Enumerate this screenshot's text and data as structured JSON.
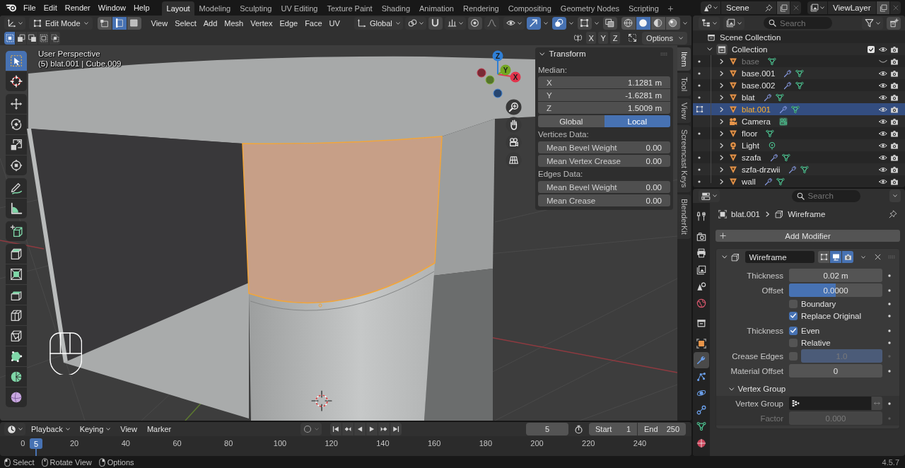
{
  "top_bar": {
    "menus": [
      "File",
      "Edit",
      "Render",
      "Window",
      "Help"
    ],
    "workspaces": [
      {
        "label": "Layout",
        "selected": true
      },
      {
        "label": "Modeling",
        "selected": false
      },
      {
        "label": "Sculpting",
        "selected": false
      },
      {
        "label": "UV Editing",
        "selected": false
      },
      {
        "label": "Texture Paint",
        "selected": false
      },
      {
        "label": "Shading",
        "selected": false
      },
      {
        "label": "Animation",
        "selected": false
      },
      {
        "label": "Rendering",
        "selected": false
      },
      {
        "label": "Compositing",
        "selected": false
      },
      {
        "label": "Geometry Nodes",
        "selected": false
      },
      {
        "label": "Scripting",
        "selected": false
      }
    ],
    "add_workspace": "+",
    "scene": "Scene",
    "view_layer": "ViewLayer"
  },
  "viewport": {
    "header": {
      "mode": "Edit Mode",
      "select_modes": [
        {
          "kind": "vertex",
          "selected": false
        },
        {
          "kind": "edge",
          "selected": true
        },
        {
          "kind": "face",
          "selected": false
        }
      ],
      "menus": [
        "View",
        "Select",
        "Add",
        "Mesh",
        "Vertex",
        "Edge",
        "Face",
        "UV"
      ],
      "orientation": "Global",
      "view_toggles": [
        {
          "kind": "gizmos",
          "on": true
        },
        {
          "kind": "overlays",
          "on": true
        },
        {
          "kind": "mesh_overlays",
          "on": false
        },
        {
          "kind": "xray",
          "on": false
        }
      ],
      "shading": [
        {
          "kind": "wireframe",
          "selected": false
        },
        {
          "kind": "solid",
          "selected": true
        },
        {
          "kind": "material",
          "selected": false
        },
        {
          "kind": "rendered",
          "selected": false
        }
      ],
      "select_ops": [
        {
          "kind": "set",
          "selected": true
        },
        {
          "kind": "extend",
          "selected": false
        },
        {
          "kind": "subtract",
          "selected": false
        },
        {
          "kind": "invert",
          "selected": false
        },
        {
          "kind": "intersect",
          "selected": false
        }
      ],
      "mirror_axes": [
        "X",
        "Y",
        "Z"
      ],
      "options": "Options"
    },
    "tool_groups": [
      {
        "tools": [
          {
            "kind": "select_box",
            "selected": true
          },
          {
            "kind": "cursor",
            "selected": false
          }
        ]
      },
      {
        "tools": [
          {
            "kind": "move",
            "selected": false
          },
          {
            "kind": "rotate",
            "selected": false
          },
          {
            "kind": "scale",
            "selected": false
          },
          {
            "kind": "transform",
            "selected": false
          }
        ]
      },
      {
        "tools": [
          {
            "kind": "annotate",
            "selected": false
          },
          {
            "kind": "measure",
            "selected": false
          }
        ]
      },
      {
        "tools": [
          {
            "kind": "add_cube",
            "selected": false
          }
        ]
      },
      {
        "tools": [
          {
            "kind": "extrude",
            "selected": false
          },
          {
            "kind": "inset",
            "selected": false
          },
          {
            "kind": "bevel",
            "selected": false
          },
          {
            "kind": "loop_cut",
            "selected": false
          },
          {
            "kind": "knife",
            "selected": false
          },
          {
            "kind": "poly_build",
            "selected": false
          },
          {
            "kind": "spin",
            "selected": false
          },
          {
            "kind": "smooth",
            "selected": false
          }
        ]
      }
    ],
    "view_name": "User Perspective",
    "object_info": "(5) blat.001 | Cube.009",
    "axes": [
      {
        "label": "X",
        "color": "#e2344c"
      },
      {
        "label": "Y",
        "color": "#74a722"
      },
      {
        "label": "Z",
        "color": "#2f7fd6"
      }
    ],
    "sidebar": {
      "tabs": [
        {
          "label": "Item",
          "selected": true
        },
        {
          "label": "Tool",
          "selected": false
        },
        {
          "label": "View",
          "selected": false
        },
        {
          "label": "Screencast Keys",
          "selected": false
        },
        {
          "label": "BlenderKit",
          "selected": false
        }
      ],
      "panel": {
        "title": "Transform",
        "expanded": true,
        "median_label": "Median:",
        "median": [
          {
            "axis": "X",
            "value": "1.1281 m"
          },
          {
            "axis": "Y",
            "value": "-1.6281 m"
          },
          {
            "axis": "Z",
            "value": "1.5009 m"
          }
        ],
        "space": [
          {
            "label": "Global",
            "selected": false
          },
          {
            "label": "Local",
            "selected": true
          }
        ],
        "groups": [
          {
            "title": "Vertices Data:",
            "fields": [
              {
                "label": "Mean Bevel Weight",
                "value": "0.00"
              },
              {
                "label": "Mean Vertex Crease",
                "value": "0.00"
              }
            ]
          },
          {
            "title": "Edges Data:",
            "fields": [
              {
                "label": "Mean Bevel Weight",
                "value": "0.00"
              },
              {
                "label": "Mean Crease",
                "value": "0.00"
              }
            ]
          }
        ]
      }
    }
  },
  "timeline": {
    "menus": [
      {
        "label": "Playback",
        "dropdown": true
      },
      {
        "label": "Keying",
        "dropdown": true
      },
      {
        "label": "View",
        "dropdown": false
      },
      {
        "label": "Marker",
        "dropdown": false
      }
    ],
    "current_frame": "5",
    "start": {
      "label": "Start",
      "value": "1"
    },
    "end": {
      "label": "End",
      "value": "250"
    },
    "ruler": [
      "0",
      "20",
      "40",
      "60",
      "80",
      "100",
      "120",
      "140",
      "160",
      "180",
      "200",
      "220",
      "240"
    ],
    "playhead": "5"
  },
  "outliner": {
    "search": {
      "placeholder": "Search"
    },
    "tree": {
      "label": "Scene Collection",
      "children": [
        {
          "label": "Collection",
          "expanded": true,
          "checked": true,
          "children": [
            {
              "name": "base",
              "kind": "mesh",
              "expanded": false,
              "modifiers": false,
              "visible": false,
              "selected": false,
              "edit_mode": false
            },
            {
              "name": "base.001",
              "kind": "mesh",
              "expanded": false,
              "modifiers": true,
              "visible": true,
              "selected": false,
              "edit_mode": false
            },
            {
              "name": "base.002",
              "kind": "mesh",
              "expanded": false,
              "modifiers": true,
              "visible": true,
              "selected": false,
              "edit_mode": false
            },
            {
              "name": "blat",
              "kind": "mesh",
              "expanded": false,
              "modifiers": true,
              "visible": true,
              "selected": false,
              "edit_mode": false
            },
            {
              "name": "blat.001",
              "kind": "mesh",
              "expanded": false,
              "modifiers": true,
              "visible": true,
              "selected": true,
              "edit_mode": true
            },
            {
              "name": "Camera",
              "kind": "camera",
              "expanded": false,
              "modifiers": false,
              "visible": true,
              "selected": false,
              "edit_mode": false
            },
            {
              "name": "floor",
              "kind": "mesh",
              "expanded": false,
              "modifiers": false,
              "visible": true,
              "selected": false,
              "edit_mode": false
            },
            {
              "name": "Light",
              "kind": "light",
              "expanded": false,
              "modifiers": false,
              "visible": true,
              "selected": false,
              "edit_mode": false
            },
            {
              "name": "szafa",
              "kind": "mesh",
              "expanded": false,
              "modifiers": true,
              "visible": true,
              "selected": false,
              "edit_mode": false
            },
            {
              "name": "szfa-drzwii",
              "kind": "mesh",
              "expanded": false,
              "modifiers": true,
              "visible": true,
              "selected": false,
              "edit_mode": false
            },
            {
              "name": "wall",
              "kind": "mesh",
              "expanded": false,
              "modifiers": true,
              "visible": true,
              "selected": false,
              "edit_mode": false
            }
          ]
        }
      ]
    }
  },
  "properties": {
    "search": {
      "placeholder": "Search"
    },
    "tab_groups": [
      {
        "tabs": [
          {
            "kind": "tool",
            "selected": false
          }
        ]
      },
      {
        "tabs": [
          {
            "kind": "render",
            "selected": false
          },
          {
            "kind": "output",
            "selected": false
          },
          {
            "kind": "view_layer",
            "selected": false
          },
          {
            "kind": "scene",
            "selected": false
          },
          {
            "kind": "world",
            "selected": false
          }
        ]
      },
      {
        "tabs": [
          {
            "kind": "collection",
            "selected": false
          }
        ]
      },
      {
        "tabs": [
          {
            "kind": "object",
            "selected": false
          },
          {
            "kind": "modifiers",
            "selected": true
          },
          {
            "kind": "particles",
            "selected": false
          },
          {
            "kind": "physics",
            "selected": false
          },
          {
            "kind": "constraints",
            "selected": false
          },
          {
            "kind": "data",
            "selected": false
          },
          {
            "kind": "material",
            "selected": false
          }
        ]
      }
    ],
    "breadcrumb": [
      {
        "kind": "object",
        "label": "blat.001"
      },
      {
        "kind": "modifier",
        "label": "Wireframe"
      }
    ],
    "add_modifier": "Add Modifier",
    "modifier": {
      "name": "Wireframe",
      "expanded": true,
      "toggles": [
        {
          "kind": "edit_mode",
          "on": false
        },
        {
          "kind": "viewport",
          "on": true
        },
        {
          "kind": "render",
          "on": true
        }
      ],
      "rows": [
        {
          "kind": "number",
          "label": "Thickness",
          "value": "0.02 m",
          "disabled": false
        },
        {
          "kind": "slider",
          "label": "Offset",
          "value": "0.0000",
          "level": 0.5,
          "disabled": false
        },
        {
          "kind": "checkbox",
          "text": "Boundary",
          "checked": false,
          "disabled": false
        },
        {
          "kind": "checkbox",
          "text": "Replace Original",
          "checked": true,
          "disabled": false
        },
        {
          "kind": "checkbox",
          "label": "Thickness",
          "text": "Even",
          "checked": true,
          "disabled": false
        },
        {
          "kind": "checkbox",
          "text": "Relative",
          "checked": false,
          "disabled": false
        },
        {
          "kind": "toggle_slider",
          "label": "Crease Edges",
          "checked": false,
          "value": "1.0",
          "level": 1,
          "disabled": true
        },
        {
          "kind": "number",
          "label": "Material Offset",
          "value": "0",
          "disabled": false
        }
      ],
      "subpanels": [
        {
          "title": "Vertex Group",
          "expanded": true,
          "rows": [
            {
              "kind": "group",
              "label": "Vertex Group",
              "disabled": false
            },
            {
              "kind": "number",
              "label": "Factor",
              "value": "0.000",
              "disabled": true
            }
          ]
        }
      ]
    }
  },
  "status_bar": {
    "hints": [
      {
        "kind": "left",
        "label": "Select"
      },
      {
        "kind": "middle",
        "label": "Rotate View"
      },
      {
        "kind": "right",
        "label": "Options"
      }
    ],
    "version": "4.5.7"
  }
}
